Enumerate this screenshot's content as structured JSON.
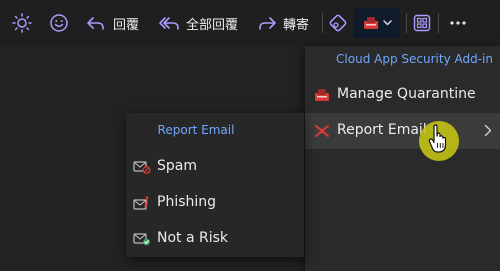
{
  "toolbar": {
    "reply_label": "回覆",
    "reply_all_label": "全部回覆",
    "forward_label": "轉寄"
  },
  "addin_menu": {
    "title": "Cloud App Security Add-in",
    "items": [
      {
        "label": "Manage Quarantine",
        "icon": "quarantine-icon"
      },
      {
        "label": "Report Email",
        "icon": "report-email-icon",
        "has_submenu": true
      }
    ]
  },
  "report_submenu": {
    "title": "Report Email",
    "items": [
      {
        "label": "Spam",
        "icon": "spam-icon"
      },
      {
        "label": "Phishing",
        "icon": "phishing-icon"
      },
      {
        "label": "Not a Risk",
        "icon": "not-a-risk-icon"
      }
    ]
  },
  "colors": {
    "accent_text": "#6fa8ff",
    "toolbar_icon_purple": "#a99cff",
    "addin_red": "#d83a3a",
    "cursor_highlight": "#c6c614"
  }
}
